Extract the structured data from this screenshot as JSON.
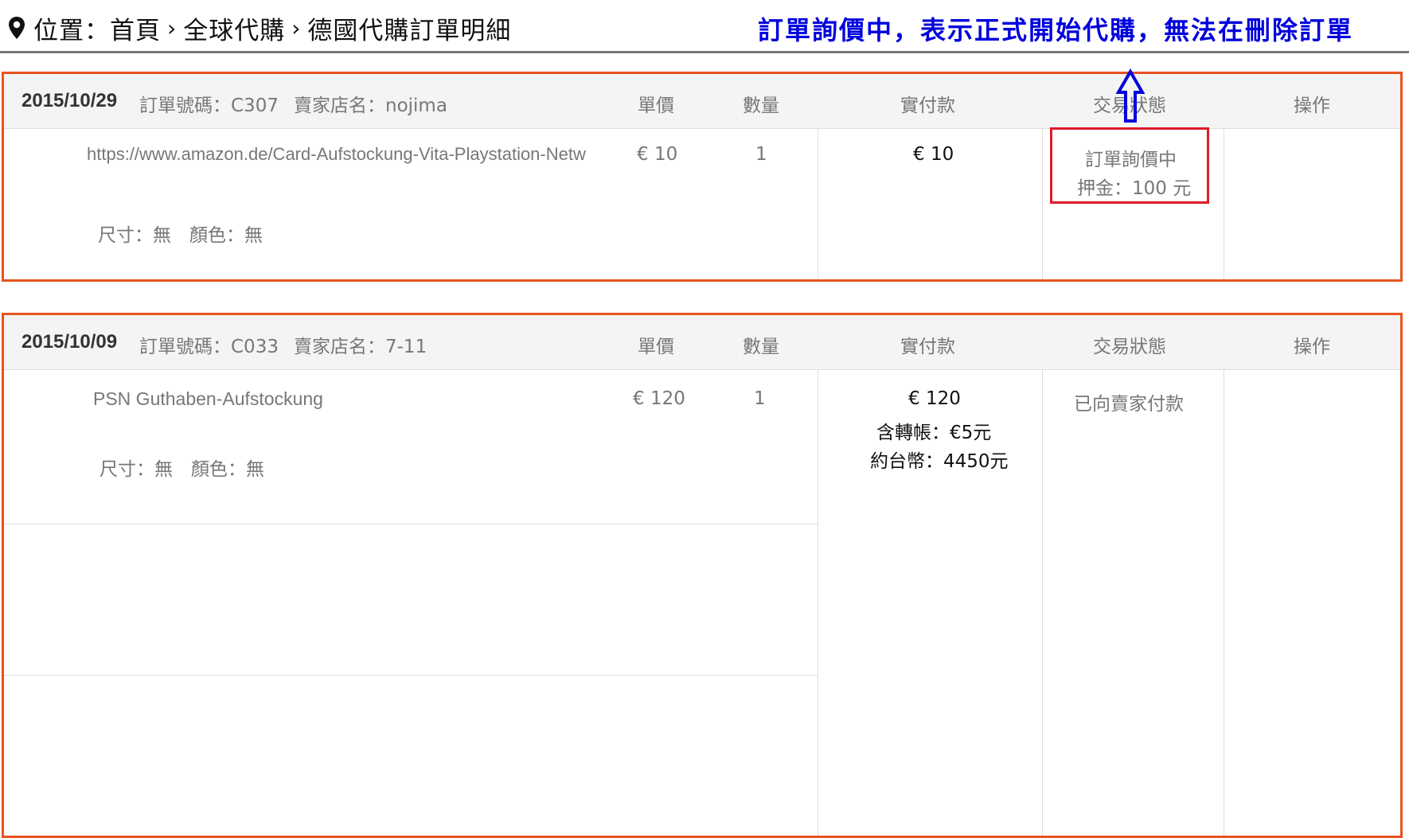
{
  "breadcrumb": {
    "items": [
      "位置：首頁",
      "全球代購",
      "德國代購訂單明細"
    ],
    "separator": "›"
  },
  "annotation": {
    "note": "訂單詢價中，表示正式開始代購，無法在刪除訂單",
    "note_color": "#0000dd",
    "highlight_color": "#e01a2a"
  },
  "columns": {
    "unit_price": "單價",
    "quantity": "數量",
    "paid": "實付款",
    "status": "交易狀態",
    "action": "操作"
  },
  "orders": [
    {
      "date": "2015/10/29",
      "order_no": "訂單號碼：C307",
      "store": "賣家店名：nojima",
      "item_title": "https://www.amazon.de/Card-Aufstockung-Vita-Playstation-Netw",
      "specs": "尺寸：無　顏色：無",
      "unit_price": "€ 10",
      "quantity": "1",
      "paid": "€ 10",
      "status_line1": "訂單詢價中",
      "status_line2": "押金：100 元"
    },
    {
      "date": "2015/10/09",
      "order_no": "訂單號碼：C033",
      "store": "賣家店名：7-11",
      "item_title": "PSN Guthaben-Aufstockung",
      "specs": "尺寸：無　顏色：無",
      "unit_price": "€ 120",
      "quantity": "1",
      "paid": "€ 120",
      "paid_transfer": "含轉帳：€5元",
      "paid_twd": "約台幣：4450元",
      "status_line1": "已向賣家付款"
    }
  ],
  "colors": {
    "order_border": "#e8541f",
    "header_bg": "#f4f4f4"
  },
  "icons": {
    "location": "map-pin-icon",
    "annotation_arrow": "up-arrow-icon"
  }
}
